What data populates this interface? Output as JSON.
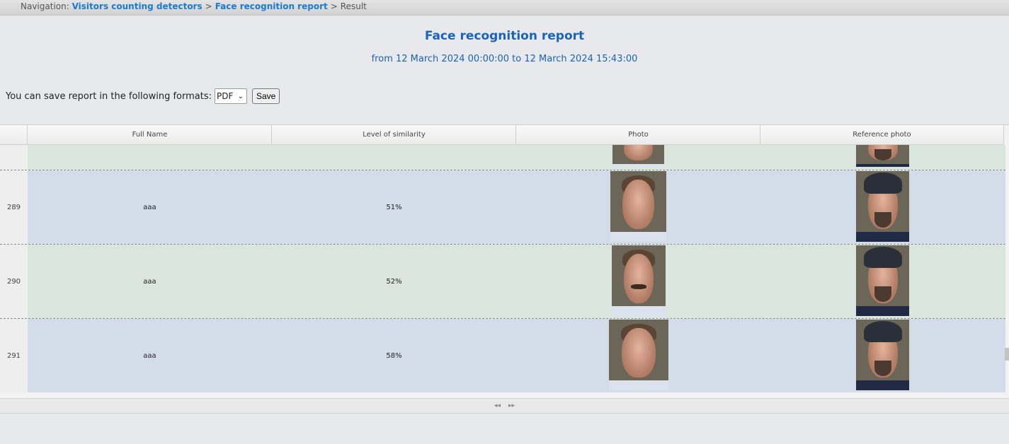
{
  "navigation": {
    "prefix": "Navigation:",
    "crumbs": [
      "Visitors counting detectors",
      "Face recognition report"
    ],
    "separator": ">",
    "current": "Result"
  },
  "report": {
    "title": "Face recognition report",
    "period": "from 12 March 2024 00:00:00 to 12 March 2024 15:43:00"
  },
  "save": {
    "label": "You can save report in the following formats:",
    "format": "PDF",
    "button": "Save"
  },
  "table": {
    "columns": [
      "Full Name",
      "Level of similarity",
      "Photo",
      "Reference photo"
    ],
    "rows": [
      {
        "num": "289",
        "name": "aaa",
        "similarity": "51%"
      },
      {
        "num": "290",
        "name": "aaa",
        "similarity": "52%"
      },
      {
        "num": "291",
        "name": "aaa",
        "similarity": "58%"
      }
    ]
  },
  "pager": {
    "prev": "◂◂",
    "next": "▸▸"
  },
  "icons": [
    "chevron-down-icon",
    "prev-page-icon",
    "next-page-icon"
  ],
  "colors": {
    "link": "#1a7bd2",
    "title": "#1a63b8",
    "row_green": "#d9e5dd",
    "row_blue": "#d3dde9"
  }
}
